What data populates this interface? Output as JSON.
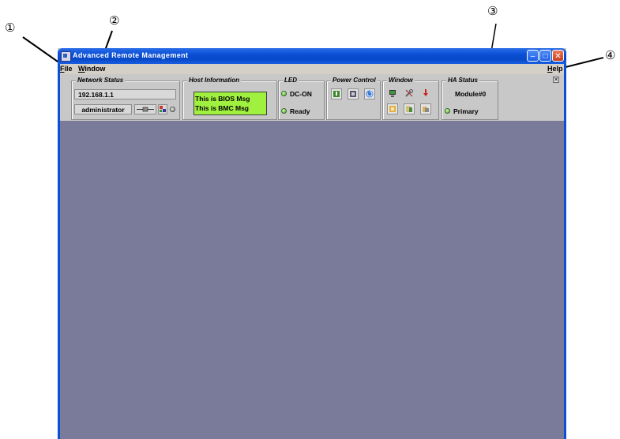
{
  "callouts": [
    "①",
    "②",
    "③",
    "④"
  ],
  "window": {
    "title": "Advanced Remote Management",
    "buttons": {
      "minimize": "–",
      "maximize": "□",
      "close": "✕"
    }
  },
  "menu": {
    "file": {
      "mnemonic": "F",
      "rest": "ile"
    },
    "window": {
      "mnemonic": "W",
      "rest": "indow"
    },
    "help": {
      "mnemonic": "H",
      "rest": "elp"
    }
  },
  "panels": {
    "network_status": {
      "title": "Network Status",
      "ip": "192.168.1.1",
      "user": "administrator"
    },
    "host_information": {
      "title": "Host Information",
      "bios_msg": "This is BIOS Msg",
      "bmc_msg": "This is BMC Msg"
    },
    "led": {
      "title": "LED",
      "dc": "DC-ON",
      "ready": "Ready"
    },
    "power_control": {
      "title": "Power Control"
    },
    "window_panel": {
      "title": "Window"
    },
    "ha_status": {
      "title": "HA Status",
      "module": "Module#0",
      "role": "Primary"
    }
  },
  "close_toolbar": "✕",
  "colors": {
    "titlebar": "#0a4fd6",
    "workspace": "#7a7a9a",
    "host_box": "#a0f040",
    "led_green": "#3aa02a"
  }
}
